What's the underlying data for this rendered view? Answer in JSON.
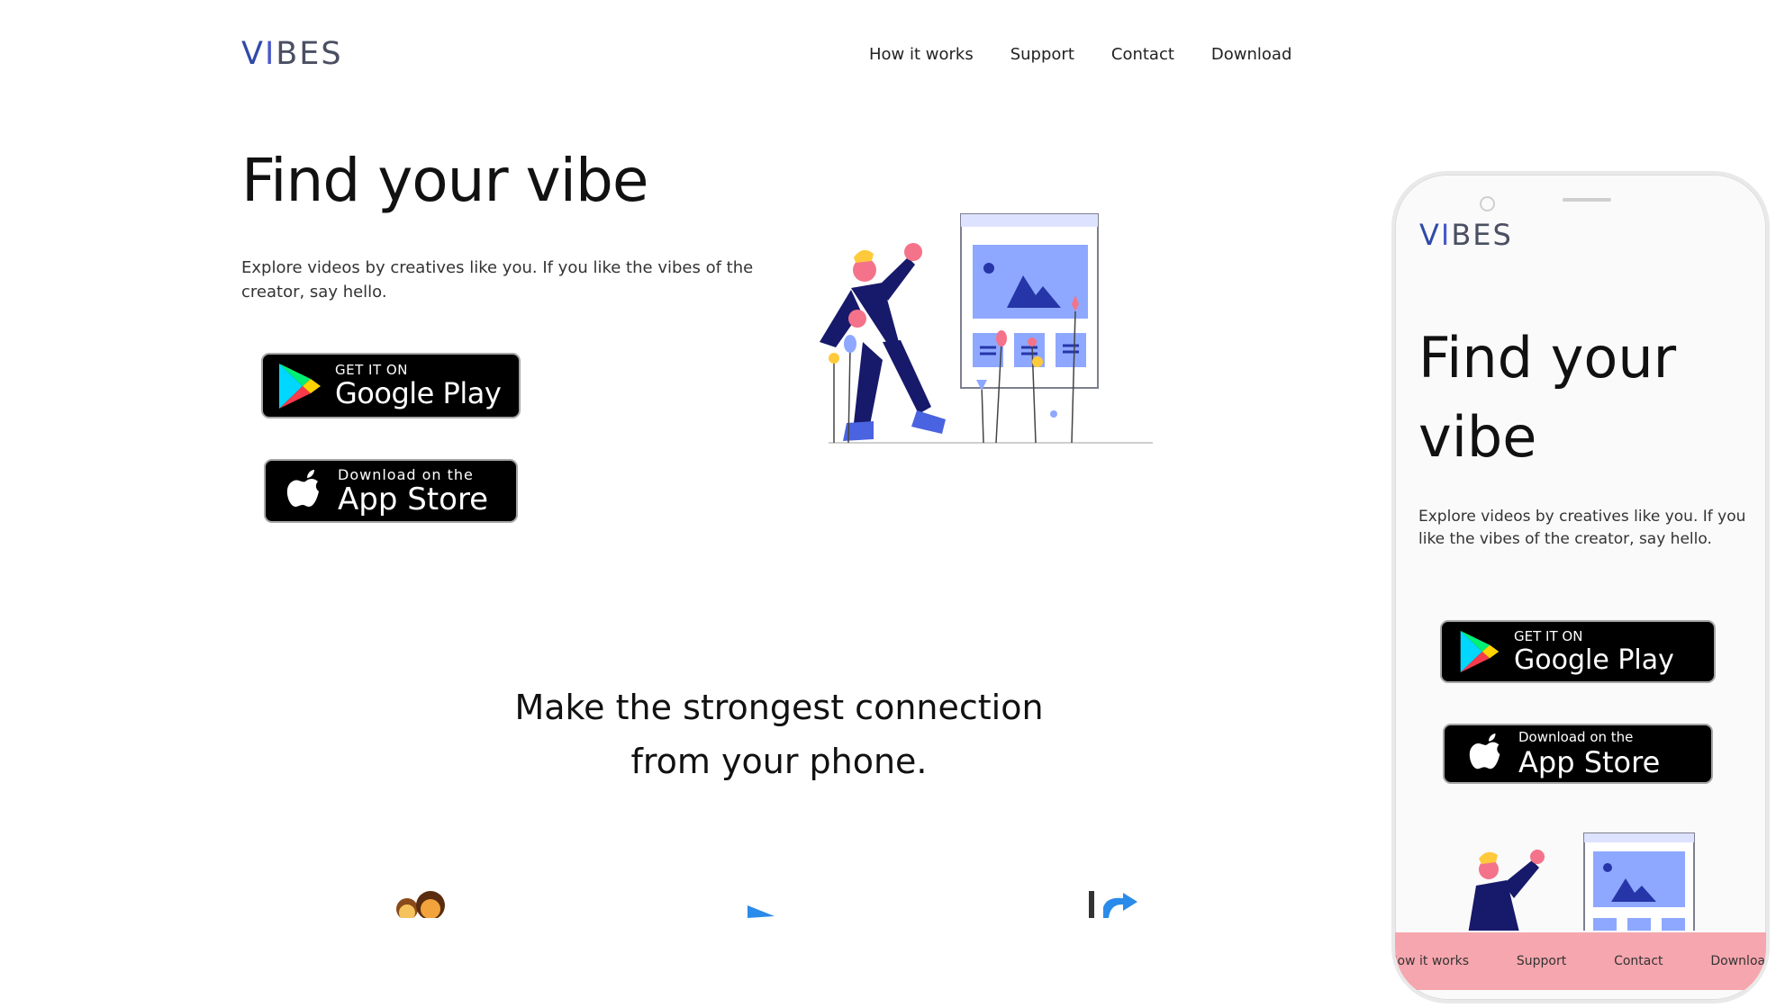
{
  "brand": {
    "logo_v": "V",
    "logo_i": "I",
    "logo_rest": "BES"
  },
  "nav": {
    "items": [
      {
        "label": "How it works"
      },
      {
        "label": "Support"
      },
      {
        "label": "Contact"
      },
      {
        "label": "Download"
      }
    ]
  },
  "hero": {
    "title": "Find your vibe",
    "description": "Explore videos by creatives like you. If you like the vibes of the creator, say hello.",
    "google_play": {
      "small": "GET IT ON",
      "big": "Google Play"
    },
    "app_store": {
      "small": "Download on the",
      "big": "App Store"
    }
  },
  "section": {
    "title_line1": "Make the strongest connection",
    "title_line2": "from your phone."
  },
  "features": {
    "icons": [
      "people-emoji-icon",
      "play-icon",
      "share-icon"
    ]
  },
  "phone_preview": {
    "logo_v": "V",
    "logo_i": "I",
    "logo_rest": "BES",
    "title": "Find your vibe",
    "description": "Explore videos by creatives like you. If you like the vibes of the creator, say hello.",
    "google_play": {
      "small": "GET IT ON",
      "big": "Google Play"
    },
    "app_store": {
      "small": "Download on the",
      "big": "App Store"
    },
    "nav": [
      "How it works",
      "Support",
      "Contact",
      "Download"
    ]
  },
  "colors": {
    "accent": "#2f4aa8",
    "phone_nav_bg": "#f6a6ae",
    "illustration_blue": "#8ea8ff",
    "figure_navy": "#17196b"
  }
}
